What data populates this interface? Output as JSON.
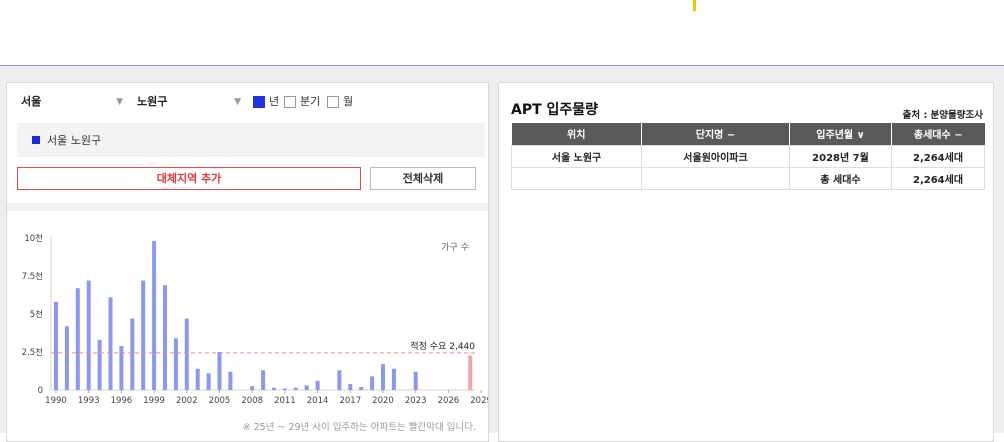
{
  "filters": {
    "city": "서울",
    "district": "노원구",
    "periods": [
      {
        "label": "년",
        "checked": true
      },
      {
        "label": "분기",
        "checked": false
      },
      {
        "label": "월",
        "checked": false
      }
    ]
  },
  "region_item": "서울 노원구",
  "buttons": {
    "add_region": "대체지역 추가",
    "delete_all": "전체삭제"
  },
  "chart_data": {
    "type": "bar",
    "legend": "가구 수",
    "ylim": [
      0,
      10000
    ],
    "y_ticks": [
      {
        "value": 0,
        "label": "0"
      },
      {
        "value": 2500,
        "label": "2.5천"
      },
      {
        "value": 5000,
        "label": "5천"
      },
      {
        "value": 7500,
        "label": "7.5천"
      },
      {
        "value": 10000,
        "label": "10천"
      }
    ],
    "x_ticks": [
      "1990",
      "1993",
      "1996",
      "1999",
      "2002",
      "2005",
      "2008",
      "2011",
      "2014",
      "2017",
      "2020",
      "2023",
      "2026",
      "2029"
    ],
    "years": [
      1990,
      1991,
      1992,
      1993,
      1994,
      1995,
      1996,
      1997,
      1998,
      1999,
      2000,
      2001,
      2002,
      2003,
      2004,
      2005,
      2006,
      2007,
      2008,
      2009,
      2010,
      2011,
      2012,
      2013,
      2014,
      2015,
      2016,
      2017,
      2018,
      2019,
      2020,
      2021,
      2022,
      2023,
      2024,
      2025,
      2026,
      2027,
      2028,
      2029
    ],
    "values": [
      5800,
      4200,
      6700,
      7200,
      3300,
      6100,
      2900,
      4700,
      7200,
      9800,
      6900,
      3400,
      4700,
      1400,
      1100,
      2500,
      1200,
      0,
      250,
      1300,
      150,
      100,
      150,
      300,
      600,
      0,
      1300,
      400,
      200,
      900,
      1700,
      1400,
      0,
      1200,
      0,
      0,
      0,
      0,
      2264,
      0
    ],
    "highlight_range": [
      2025,
      2029
    ],
    "reference": {
      "value": 2440,
      "label": "적정 수요 2,440"
    },
    "colors": {
      "bar": "#8c97ee",
      "highlight": "#f4a4a4",
      "reference": "#f08a8a"
    }
  },
  "chart_note": "※ 25년 ~ 29년 사이 입주하는 아파트는 빨간막대 입니다.",
  "table": {
    "title": "APT 입주물량",
    "source": "출처 : 분양물량조사",
    "headers": [
      "위치",
      "단지명 −",
      "입주년월 ∨",
      "총세대수 −"
    ],
    "rows": [
      [
        "서울 노원구",
        "서울원아이파크",
        "2028년 7월",
        "2,264세대"
      ],
      [
        "",
        "",
        "총 세대수",
        "2,264세대"
      ]
    ]
  }
}
